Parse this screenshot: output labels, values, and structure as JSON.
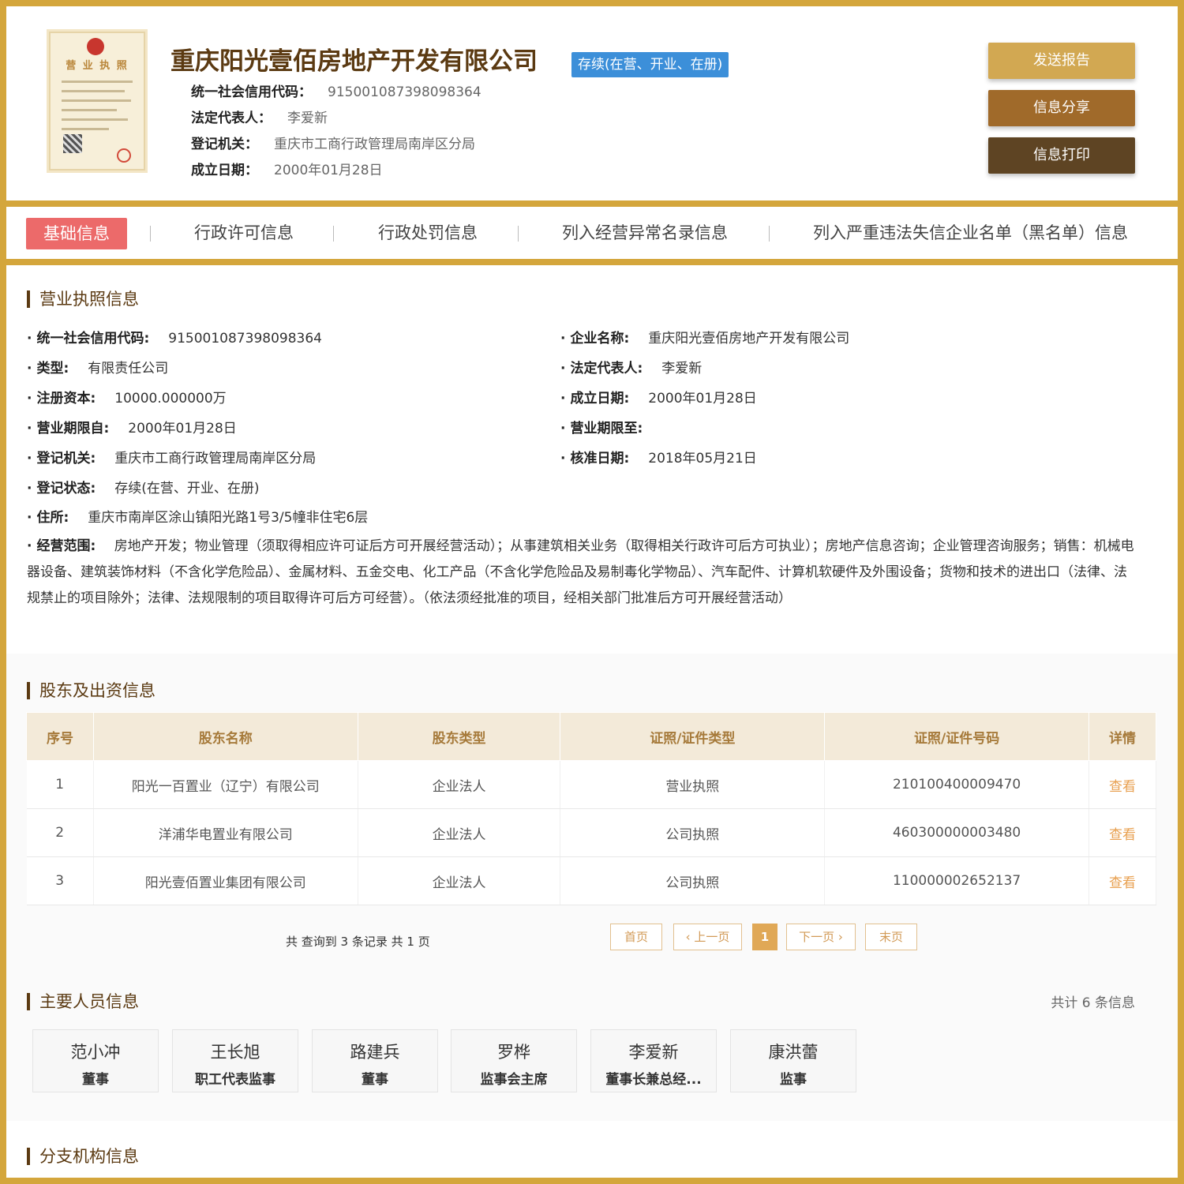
{
  "header": {
    "company_name": "重庆阳光壹佰房地产开发有限公司",
    "status": "存续(在营、开业、在册)",
    "license_title": "营 业 执 照",
    "rows": [
      {
        "label": "统一社会信用代码：",
        "value": "915001087398098364"
      },
      {
        "label": "法定代表人：",
        "value": "李爱新"
      },
      {
        "label": "登记机关：",
        "value": "重庆市工商行政管理局南岸区分局"
      },
      {
        "label": "成立日期：",
        "value": "2000年01月28日"
      }
    ],
    "buttons": {
      "send_report": "发送报告",
      "share": "信息分享",
      "print": "信息打印"
    },
    "colors": {
      "send": "#d2a852",
      "share": "#a06a2a",
      "print": "#5e4423",
      "status": "#3c8fd9"
    }
  },
  "tabs": [
    {
      "label": "基础信息",
      "active": true
    },
    {
      "label": "行政许可信息"
    },
    {
      "label": "行政处罚信息"
    },
    {
      "label": "列入经营异常名录信息"
    },
    {
      "label": "列入严重违法失信企业名单（黑名单）信息"
    }
  ],
  "license_section": {
    "title": "营业执照信息",
    "left": [
      {
        "label": "统一社会信用代码:",
        "value": "915001087398098364"
      },
      {
        "label": "类型:",
        "value": "有限责任公司"
      },
      {
        "label": "注册资本:",
        "value": "10000.000000万"
      },
      {
        "label": "营业期限自:",
        "value": "2000年01月28日"
      },
      {
        "label": "登记机关:",
        "value": "重庆市工商行政管理局南岸区分局"
      },
      {
        "label": "登记状态:",
        "value": "存续(在营、开业、在册)"
      },
      {
        "label": "住所:",
        "value": "重庆市南岸区涂山镇阳光路1号3/5幢非住宅6层"
      }
    ],
    "right": [
      {
        "label": "企业名称:",
        "value": "重庆阳光壹佰房地产开发有限公司"
      },
      {
        "label": "法定代表人:",
        "value": "李爱新"
      },
      {
        "label": "成立日期:",
        "value": "2000年01月28日"
      },
      {
        "label": "营业期限至:",
        "value": ""
      },
      {
        "label": "核准日期:",
        "value": "2018年05月21日"
      }
    ],
    "scope_label": "经营范围:",
    "scope_value": "房地产开发；物业管理（须取得相应许可证后方可开展经营活动）；从事建筑相关业务（取得相关行政许可后方可执业）；房地产信息咨询；企业管理咨询服务；销售：机械电器设备、建筑装饰材料（不含化学危险品）、金属材料、五金交电、化工产品（不含化学危险品及易制毒化学物品）、汽车配件、计算机软硬件及外围设备；货物和技术的进出口（法律、法规禁止的项目除外；法律、法规限制的项目取得许可后方可经营）。（依法须经批准的项目，经相关部门批准后方可开展经营活动）"
  },
  "shareholder_section": {
    "title": "股东及出资信息",
    "headers": [
      "序号",
      "股东名称",
      "股东类型",
      "证照/证件类型",
      "证照/证件号码",
      "详情"
    ],
    "rows": [
      [
        "1",
        "阳光一百置业（辽宁）有限公司",
        "企业法人",
        "营业执照",
        "210100400009470",
        "查看"
      ],
      [
        "2",
        "洋浦华电置业有限公司",
        "企业法人",
        "公司执照",
        "460300000003480",
        "查看"
      ],
      [
        "3",
        "阳光壹佰置业集团有限公司",
        "企业法人",
        "公司执照",
        "110000002652137",
        "查看"
      ]
    ],
    "pager": {
      "summary": "共 查询到 3 条记录 共 1 页",
      "first": "首页",
      "prev": "‹ 上一页",
      "current": "1",
      "next": "下一页 ›",
      "last": "末页"
    }
  },
  "personnel_section": {
    "title": "主要人员信息",
    "count": "共计 6 条信息",
    "people": [
      {
        "name": "范小冲",
        "role": "董事"
      },
      {
        "name": "王长旭",
        "role": "职工代表监事"
      },
      {
        "name": "路建兵",
        "role": "董事"
      },
      {
        "name": "罗桦",
        "role": "监事会主席"
      },
      {
        "name": "李爱新",
        "role": "董事长兼总经..."
      },
      {
        "name": "康洪蕾",
        "role": "监事"
      }
    ]
  },
  "branch_section": {
    "title": "分支机构信息"
  }
}
